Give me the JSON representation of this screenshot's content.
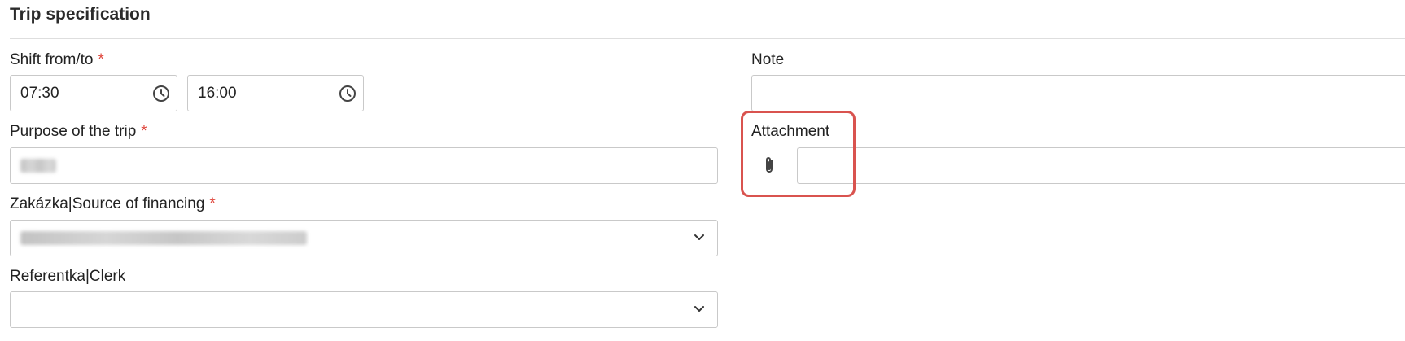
{
  "section": {
    "title": "Trip specification"
  },
  "shift": {
    "label": "Shift from/to",
    "required_mark": "*",
    "from_value": "07:30",
    "to_value": "16:00"
  },
  "note": {
    "label": "Note",
    "value": ""
  },
  "purpose": {
    "label": "Purpose of the trip",
    "required_mark": "*",
    "value_redacted": "(blurred text)"
  },
  "attachment": {
    "label": "Attachment",
    "value": ""
  },
  "financing": {
    "label": "Zakázka|Source of financing",
    "required_mark": "*",
    "value_redacted": "(blurred text)"
  },
  "clerk": {
    "label": "Referentka|Clerk",
    "value": ""
  },
  "colors": {
    "required": "#e0493f",
    "highlight": "#d9534f",
    "border": "#c9c9c9"
  },
  "icons": [
    "clock-icon",
    "paperclip-icon",
    "chevron-down-icon"
  ]
}
